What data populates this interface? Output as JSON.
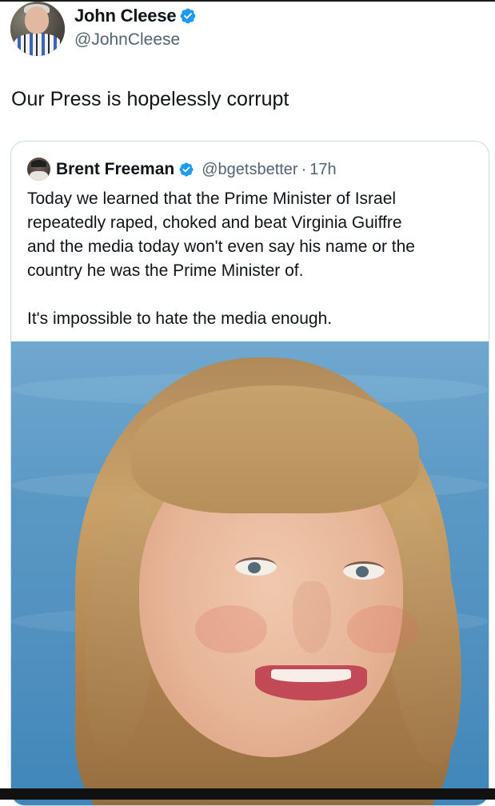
{
  "post": {
    "author": {
      "name": "John Cleese",
      "handle": "@JohnCleese",
      "verified": true,
      "avatar_icon": "profile-photo-man-striped-shirt"
    },
    "text": "Our Press is hopelessly corrupt"
  },
  "quoted_post": {
    "author": {
      "name": "Brent Freeman",
      "handle": "@bgetsbetter",
      "verified": true,
      "avatar_icon": "profile-photo-man-cap"
    },
    "separator": "·",
    "time": "17h",
    "paragraphs": [
      "Today we learned that the Prime Minister of Israel",
      "repeatedly raped, choked and beat Virginia Guiffre",
      "and the media today won't even say his name or the",
      "country he was the Prime Minister of."
    ],
    "closing": "It's impossible to hate the media enough.",
    "media": {
      "type": "photo",
      "subject_icon": "portrait-photo-young-woman-smiling-blue-water-background"
    }
  },
  "colors": {
    "verified_badge": "#1d9bf0",
    "secondary_text": "#536471",
    "card_border": "#cfd9de"
  }
}
